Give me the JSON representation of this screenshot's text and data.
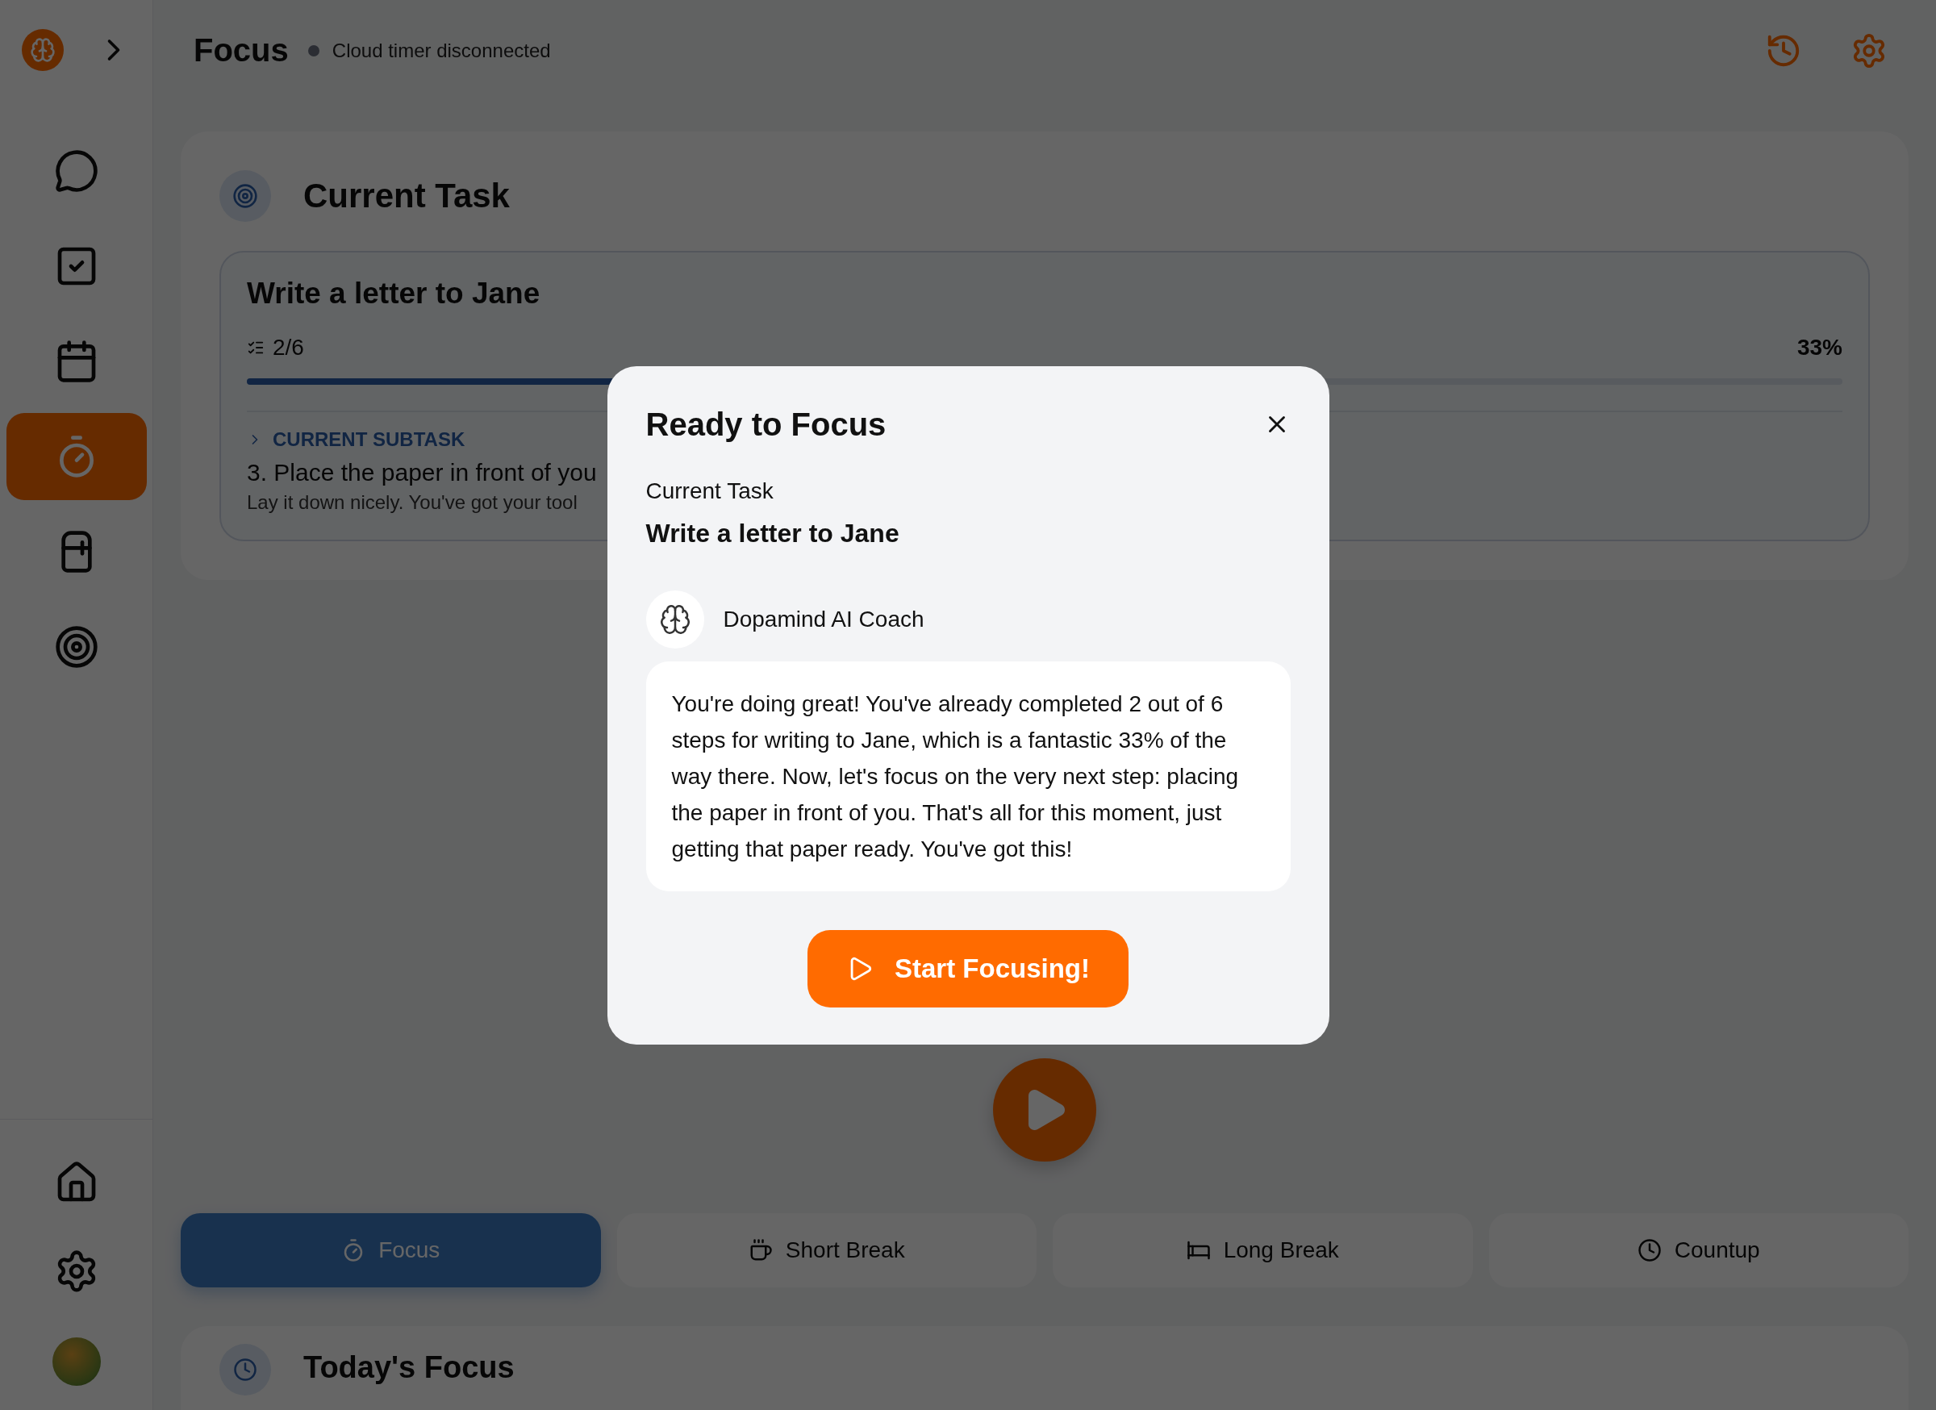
{
  "header": {
    "title": "Focus",
    "status": "Cloud timer disconnected",
    "connected": false
  },
  "sidebar": {
    "items": [
      {
        "selected": false
      },
      {
        "selected": false
      },
      {
        "selected": false
      },
      {
        "selected": true
      },
      {
        "selected": false
      },
      {
        "selected": false
      }
    ]
  },
  "current_task": {
    "heading": "Current Task",
    "task": "Write a letter to Jane",
    "steps": "2/6",
    "percent": "33%",
    "level": 0.33,
    "subtask_label": "CURRENT SUBTASK",
    "subtask": "3. Place the paper in front of you",
    "subtask_note": "Lay it down nicely. You've got your tool"
  },
  "modes": [
    {
      "label": "Focus",
      "selected": true
    },
    {
      "label": "Short Break",
      "selected": false
    },
    {
      "label": "Long Break",
      "selected": false
    },
    {
      "label": "Countup",
      "selected": false
    }
  ],
  "todays_focus": {
    "heading": "Today's Focus"
  },
  "dialog": {
    "title": "Ready to Focus",
    "task_label": "Current Task",
    "task": "Write a letter to Jane",
    "coach": "Dopamind AI Coach",
    "message": "You're doing great! You've already completed 2 out of 6 steps for writing to Jane, which is a fantastic 33% of the way there. Now, let's focus on the very next step: placing the paper in front of you. That's all for this moment, just getting that paper ready. You've got this!",
    "button": "Start Focusing!"
  }
}
